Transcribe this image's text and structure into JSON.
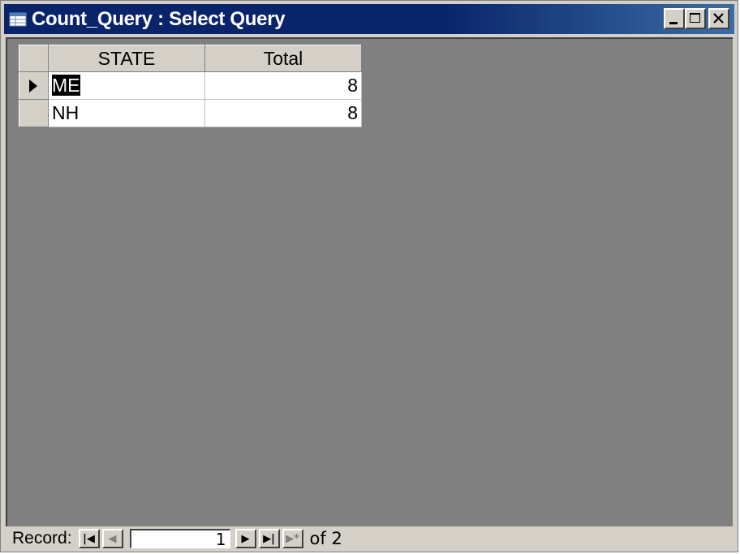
{
  "window": {
    "title": "Count_Query : Select Query",
    "title_bar_color": "#0a246a",
    "app_icon": "datasheet-icon"
  },
  "title_buttons": {
    "minimize_icon": "minimize-icon",
    "maximize_icon": "maximize-icon",
    "close_icon": "close-icon"
  },
  "datasheet": {
    "columns": [
      "STATE",
      "Total"
    ],
    "rows": [
      {
        "state": "ME",
        "total": "8",
        "current": true
      },
      {
        "state": "NH",
        "total": "8",
        "current": false
      }
    ],
    "background_color": "#808080"
  },
  "navigation": {
    "label": "Record:",
    "first_icon": "first-record-icon",
    "prev_icon": "previous-record-icon",
    "current_record": "1",
    "next_icon": "next-record-icon",
    "last_icon": "last-record-icon",
    "new_icon": "new-record-icon",
    "of_text": "of 2"
  }
}
